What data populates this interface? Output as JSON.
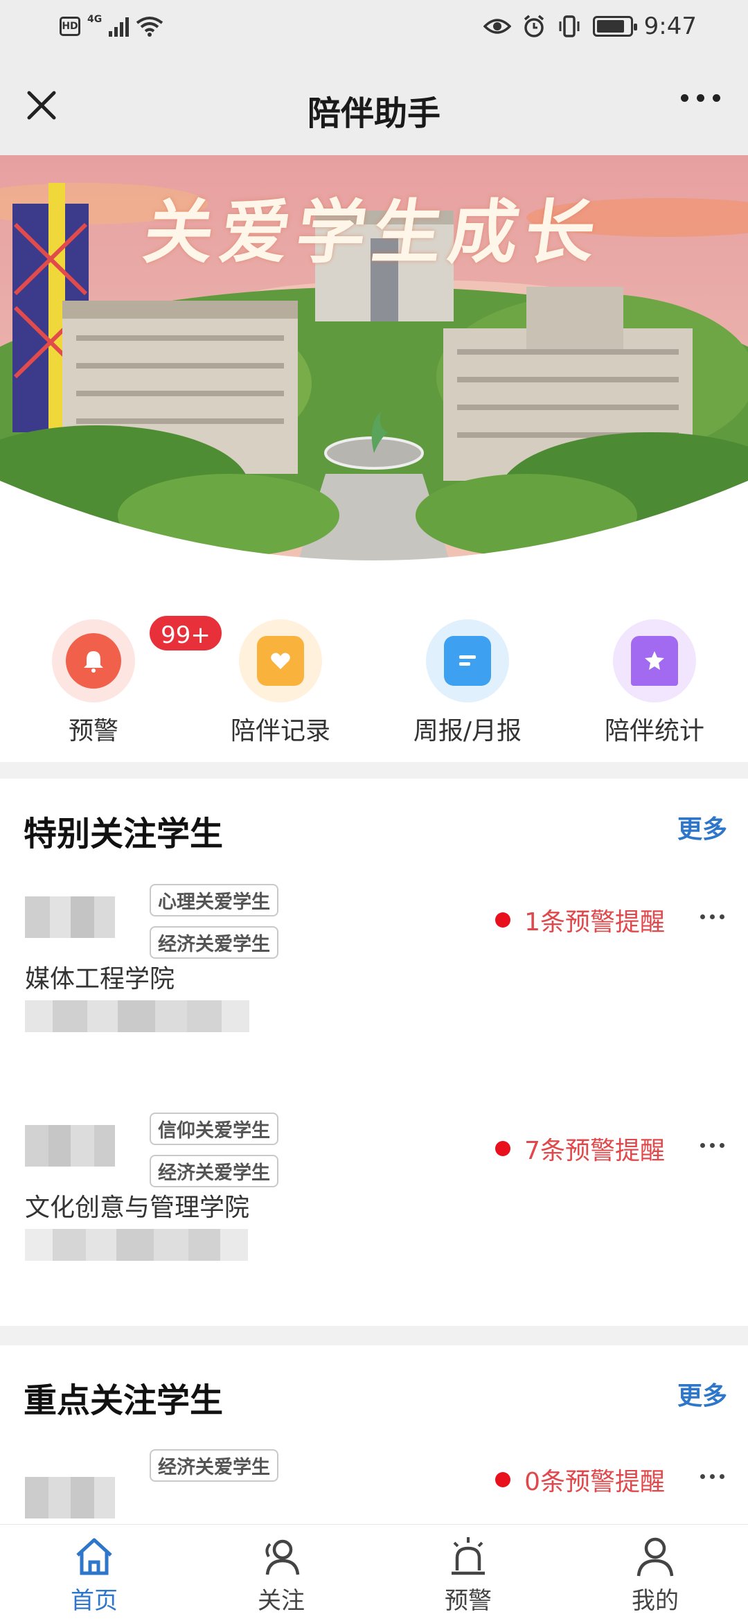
{
  "status_bar": {
    "hd": "HD",
    "network": "4G",
    "time": "9:47",
    "battery_level_pct": 85
  },
  "nav": {
    "title": "陪伴助手"
  },
  "banner": {
    "title": "关爱学生成长"
  },
  "quick_actions": [
    {
      "label": "预警",
      "icon": "bell-icon",
      "badge": "99+",
      "color": "#f0604a",
      "halo": "#fde6e2"
    },
    {
      "label": "陪伴记录",
      "icon": "heart-card-icon",
      "color": "#f9b33c",
      "halo": "#fff1dc"
    },
    {
      "label": "周报/月报",
      "icon": "report-icon",
      "color": "#3ea0f0",
      "halo": "#e0f0fd"
    },
    {
      "label": "陪伴统计",
      "icon": "star-bookmark-icon",
      "color": "#a26af0",
      "halo": "#f1e6fd"
    }
  ],
  "special_section": {
    "title": "特别关注学生",
    "more": "更多",
    "students": [
      {
        "tags": [
          "心理关爱学生",
          "经济关爱学生"
        ],
        "warning": "1条预警提醒",
        "college": "媒体工程学院"
      },
      {
        "tags": [
          "信仰关爱学生",
          "经济关爱学生"
        ],
        "warning": "7条预警提醒",
        "college": "文化创意与管理学院"
      }
    ]
  },
  "key_section": {
    "title": "重点关注学生",
    "more": "更多",
    "students": [
      {
        "tags": [
          "经济关爱学生"
        ],
        "warning": "0条预警提醒"
      }
    ]
  },
  "tabbar": [
    {
      "label": "首页",
      "icon": "home-icon",
      "active": true
    },
    {
      "label": "关注",
      "icon": "follow-users-icon",
      "active": false
    },
    {
      "label": "预警",
      "icon": "alarm-light-icon",
      "active": false
    },
    {
      "label": "我的",
      "icon": "profile-icon",
      "active": false
    }
  ],
  "colors": {
    "accent": "#2d76c9",
    "warning_text": "#e0484b",
    "warning_dot": "#e8101c",
    "badge": "#e8303a"
  }
}
